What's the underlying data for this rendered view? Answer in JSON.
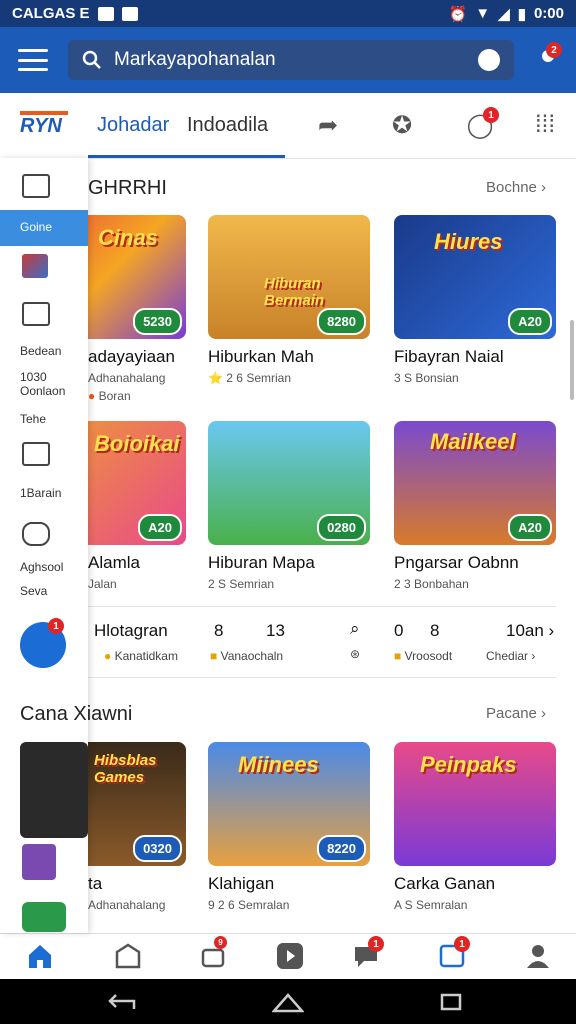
{
  "status": {
    "left": "CALGAS E",
    "time": "0:00"
  },
  "search": {
    "placeholder": "Markayapohanalan",
    "notif_count": "2"
  },
  "tabs": {
    "logo": "RYN",
    "tab1": "Johadar",
    "tab2": "Indoadila"
  },
  "tab_icons": [
    "share-icon",
    "puzzle-icon",
    "chat-icon",
    "apps-grid-icon"
  ],
  "tab_badge": "1",
  "sidebar": {
    "active": "Goine",
    "labels": [
      "Bedean",
      "1030",
      "Oonlaon",
      "Tehe",
      "1Barain",
      "Aghsool",
      "Seva"
    ],
    "fab_badge": "1"
  },
  "section1": {
    "title": "GHRRHI",
    "more": "Bochne"
  },
  "section2": {
    "title": "Cana Xiawni",
    "more": "Pacane"
  },
  "cards_row1": [
    {
      "title": "adayayiaan",
      "sub1": "Adhanahalang",
      "sub2": "Boran",
      "pill": "5230",
      "art": "Cinas"
    },
    {
      "title": "Hiburkan Mah",
      "sub1": "2 6",
      "sub2": "Semrian",
      "pill": "8280",
      "art": "Hiburan Bermain"
    },
    {
      "title": "Fibayran Naial",
      "sub1": "3 S",
      "sub2": "Bonsian",
      "pill": "A20",
      "art": "Hiures"
    }
  ],
  "cards_row2": [
    {
      "title": "Alamla",
      "sub1": "Jalan",
      "pill": "A20",
      "art": "Boioikai"
    },
    {
      "title": "Hiburan Mapa",
      "sub1": "2 S",
      "sub2": "Semrian",
      "pill": "0280",
      "art": ""
    },
    {
      "title": "Pngarsar Oabnn",
      "sub1": "2 3",
      "sub2": "Bonbahan",
      "pill": "A20",
      "art": "Mailkeel"
    }
  ],
  "row3": {
    "title": "Hlotagran",
    "sub": "Kanatidkam",
    "n1": "8",
    "n2": "13",
    "sub2": "Vanaochaln",
    "n3": "0",
    "n4": "8",
    "sub3": "Vroosodt",
    "n5": "10an",
    "sub4": "Chediar"
  },
  "cards_row4": [
    {
      "title": "ta",
      "sub1": "Adhanahalang",
      "pill": "0320",
      "art": "Hibsblas Games"
    },
    {
      "title": "Klahigan",
      "sub1": "9 2 6",
      "sub2": "Semralan",
      "pill": "8220",
      "art": "Miinees"
    },
    {
      "title": "Carka Ganan",
      "sub1": "A S",
      "sub2": "Semralan",
      "pill": "",
      "art": "Peinpaks"
    }
  ],
  "bottomnav": {
    "badge1": "9",
    "badge2": "1",
    "badge3": "1"
  },
  "colors": {
    "brand": "#1c5bb8",
    "badge": "#e02525",
    "pill": "#1f8a3b"
  }
}
